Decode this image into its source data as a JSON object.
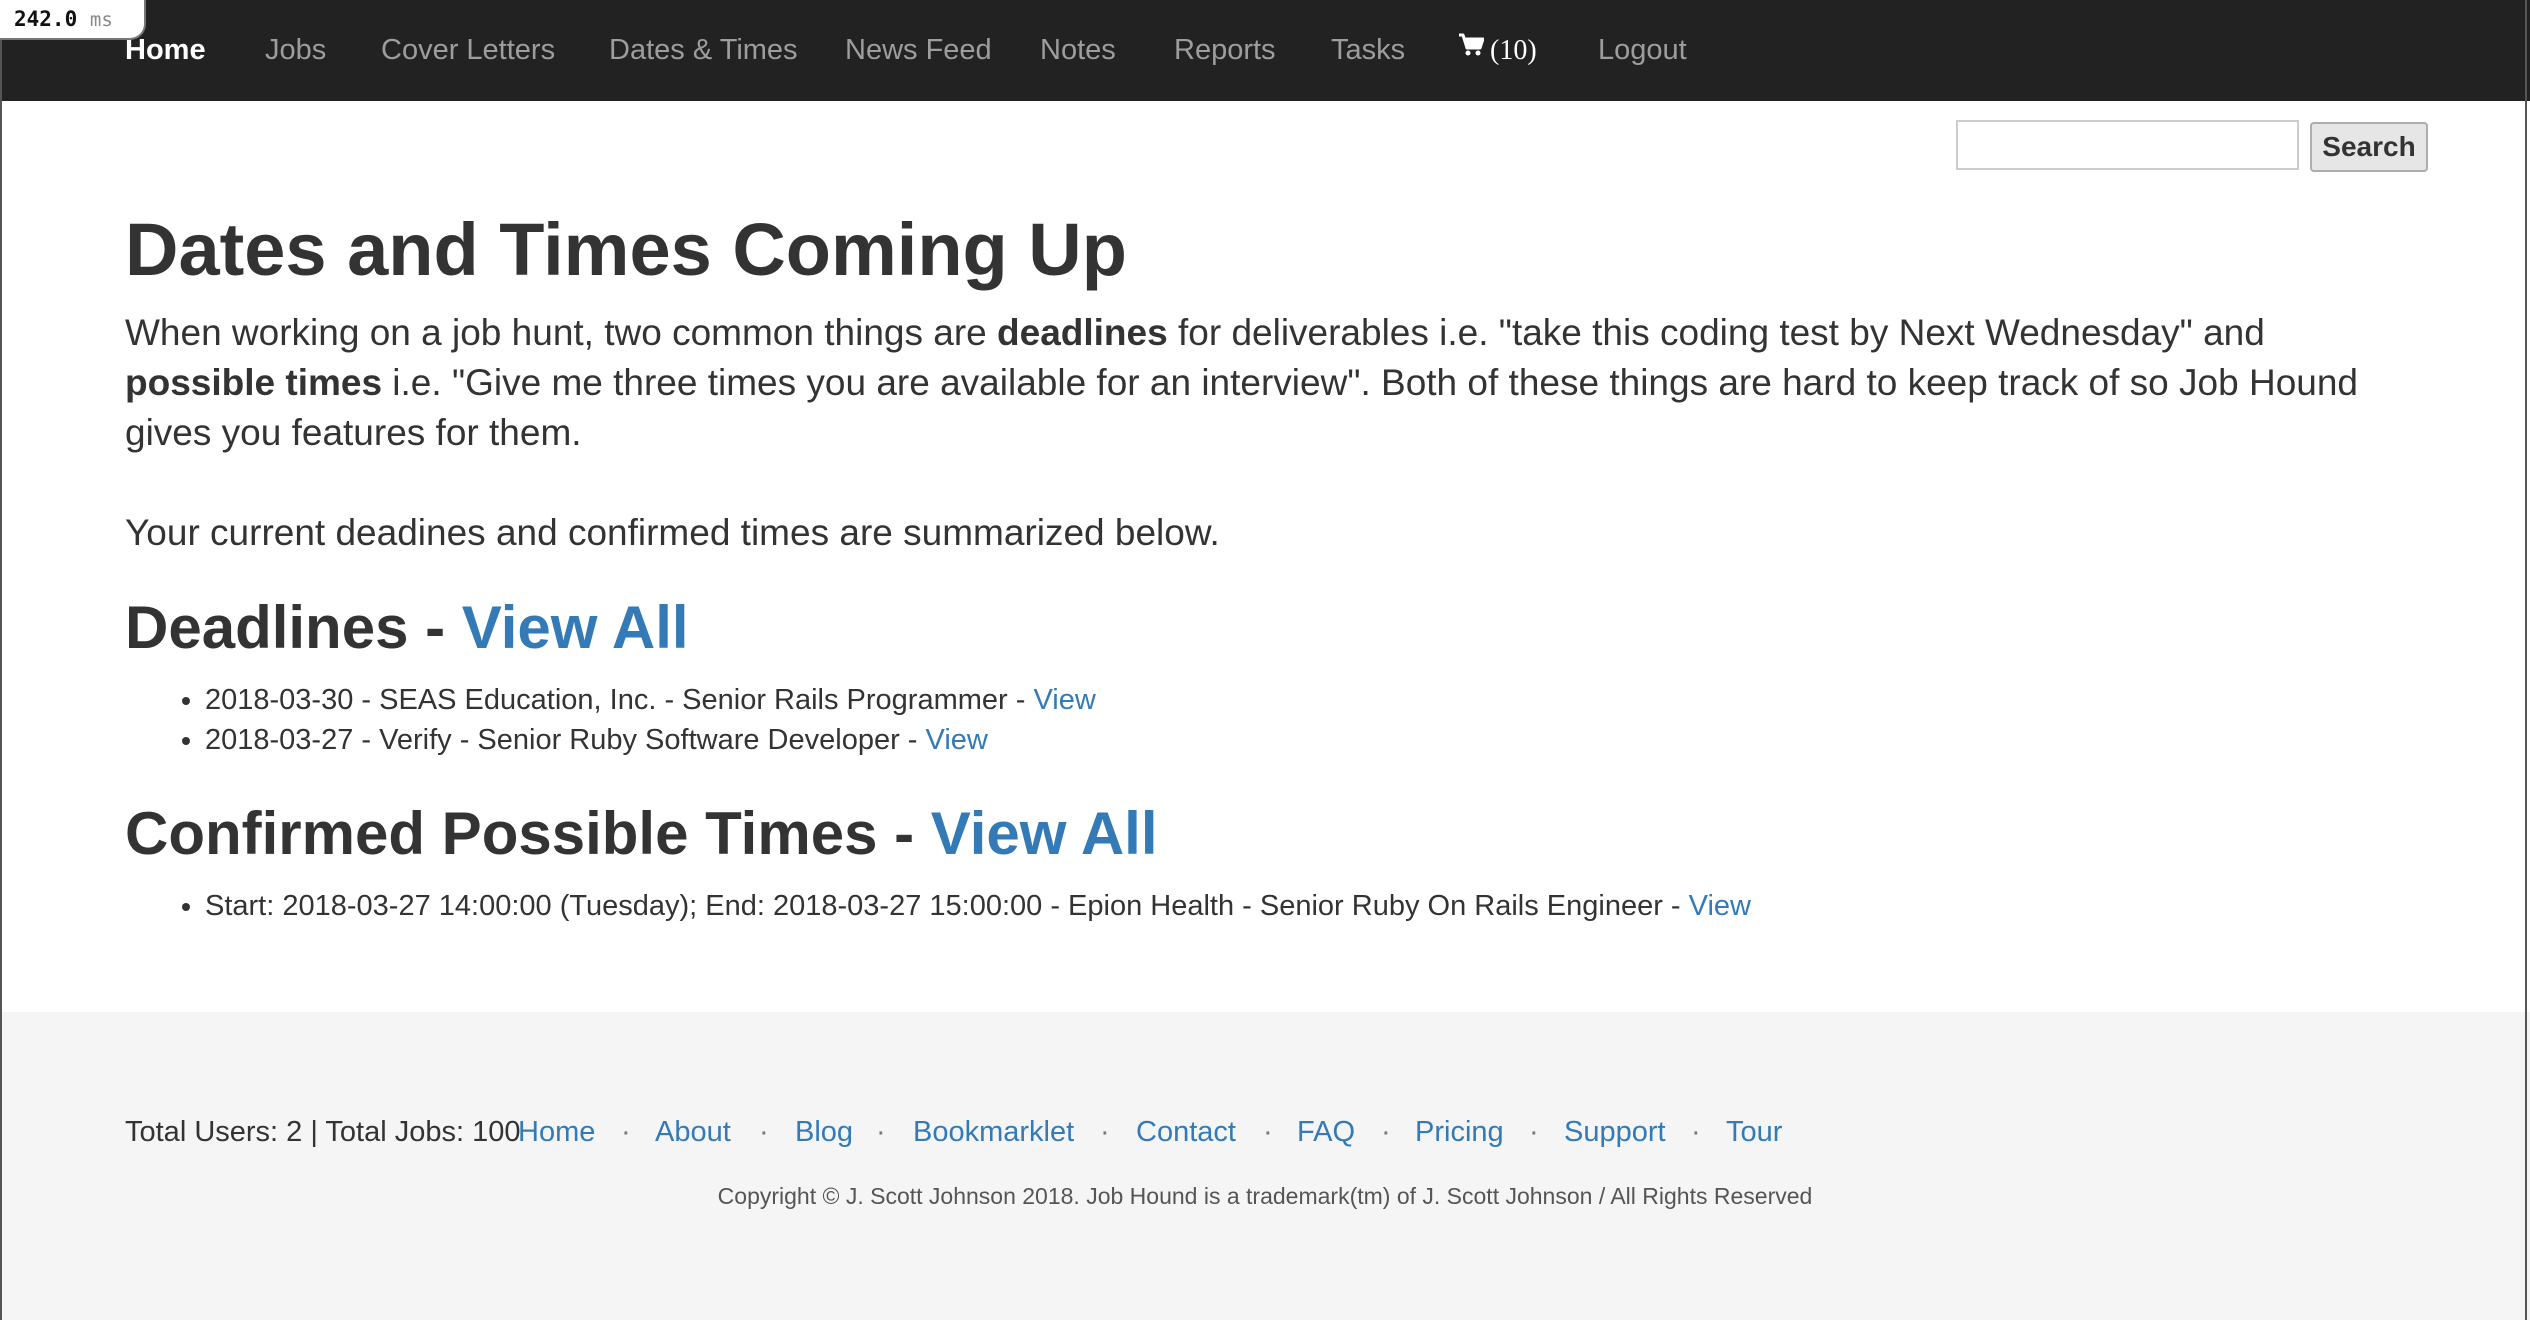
{
  "timing": {
    "value": "242.0",
    "unit": "ms"
  },
  "nav": {
    "home": "Home",
    "jobs": "Jobs",
    "cover_letters": "Cover Letters",
    "dates_times": "Dates & Times",
    "news_feed": "News Feed",
    "notes": "Notes",
    "reports": "Reports",
    "tasks": "Tasks",
    "cart_count": "(10)",
    "logout": "Logout"
  },
  "search": {
    "placeholder": "",
    "value": "",
    "button_label": "Search"
  },
  "main": {
    "title": "Dates and Times Coming Up",
    "intro": {
      "part1": "When working on a job hunt, two common things are ",
      "bold1": "deadlines",
      "part2": " for deliverables i.e. \"take this coding test by Next Wednesday\" and ",
      "bold2": "possible times",
      "part3": " i.e. \"Give me three times you are available for an interview\". Both of these things are hard to keep track of so Job Hound gives you features for them."
    },
    "summary": "Your current deadines and confirmed times are summarized below.",
    "deadlines": {
      "heading": "Deadlines - ",
      "view_all": "View All",
      "items": [
        {
          "text": "2018-03-30 - SEAS Education, Inc. - Senior Rails Programmer - ",
          "link": "View"
        },
        {
          "text": "2018-03-27 - Verify - Senior Ruby Software Developer - ",
          "link": "View"
        }
      ]
    },
    "confirmed_times": {
      "heading": "Confirmed Possible Times - ",
      "view_all": "View All",
      "items": [
        {
          "text": "Start: 2018-03-27 14:00:00 (Tuesday); End: 2018-03-27 15:00:00 - Epion Health - Senior Ruby On Rails Engineer - ",
          "link": "View"
        }
      ]
    }
  },
  "footer": {
    "stats": "Total Users: 2 | Total Jobs: 100",
    "separator": "·",
    "links": [
      "Home",
      "About",
      "Blog",
      "Bookmarklet",
      "Contact",
      "FAQ",
      "Pricing",
      "Support",
      "Tour"
    ],
    "copyright": "Copyright © J. Scott Johnson 2018. Job Hound is a trademark(tm) of J. Scott Johnson / All Rights Reserved"
  }
}
